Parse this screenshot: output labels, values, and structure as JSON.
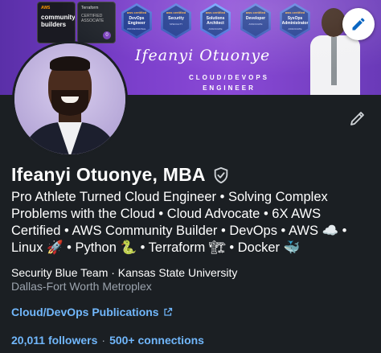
{
  "banner": {
    "aws_builders_small": "AWS",
    "aws_builders_text": "community builders",
    "terraform_label": "Terraform",
    "terraform_cert": "CERTIFIED ASSOCIATE",
    "terraform_num": "0",
    "badges": [
      {
        "aws": "aws certified",
        "title": "DevOps Engineer",
        "level": "PROFESSIONAL"
      },
      {
        "aws": "aws certified",
        "title": "Security",
        "level": "SPECIALTY"
      },
      {
        "aws": "aws certified",
        "title": "Solutions Architect",
        "level": "ASSOCIATE"
      },
      {
        "aws": "aws certified",
        "title": "Developer",
        "level": "ASSOCIATE"
      },
      {
        "aws": "aws certified",
        "title": "SysOps Administrator",
        "level": "ASSOCIATE"
      }
    ],
    "script_name": "Ifeanyi Otuonye",
    "subtitle_line1": "CLOUD/DEVOPS",
    "subtitle_line2": "ENGINEER"
  },
  "profile": {
    "name": "Ifeanyi Otuonye, MBA",
    "headline": "Pro Athlete Turned Cloud Engineer • Solving Complex Problems with the Cloud • Cloud Advocate •  6X AWS Certified • AWS Community Builder • DevOps • AWS ☁️ • Linux 🚀 • Python 🐍 • Terraform 🏗 • Docker 🐳",
    "education": "Security Blue Team · Kansas State University",
    "location": "Dallas-Fort Worth Metroplex",
    "publications_link": "Cloud/DevOps Publications",
    "followers": "20,011 followers",
    "separator": "·",
    "connections": "500+ connections"
  },
  "colors": {
    "page_bg": "#1b1f23",
    "link": "#71b7fb",
    "muted": "#9ba3ad",
    "banner_purple": "#7b3fcb"
  },
  "icons": [
    "pencil-icon",
    "edit-profile-pencil-icon",
    "verified-shield-icon",
    "external-link-icon"
  ]
}
